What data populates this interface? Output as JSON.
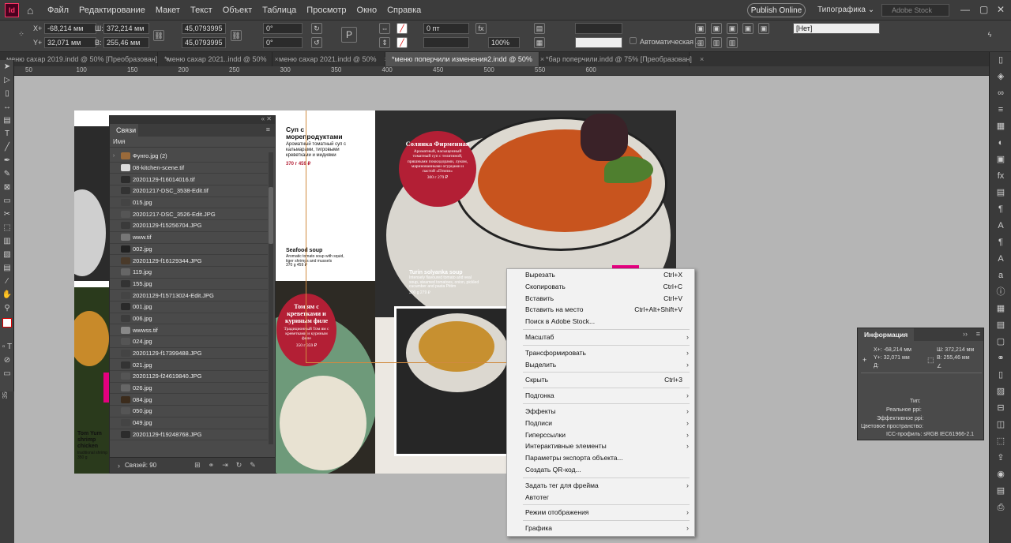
{
  "app": {
    "logo": "Id"
  },
  "menu": [
    "Файл",
    "Редактирование",
    "Макет",
    "Текст",
    "Объект",
    "Таблица",
    "Просмотр",
    "Окно",
    "Справка"
  ],
  "topbar": {
    "publish": "Publish Online",
    "workspace": "Типографика",
    "stock_placeholder": "Adobe Stock"
  },
  "control": {
    "x_label": "X+",
    "x_value": "-68,214 мм",
    "y_label": "Y+",
    "y_value": "32,071 мм",
    "w_label": "Ш:",
    "w_value": "372,214 мм",
    "h_label": "В:",
    "h_value": "255,46 мм",
    "scale_x": "45,0793995",
    "scale_y": "45,0793995",
    "rotate": "0°",
    "shear": "0°",
    "stroke": "0 пт",
    "opacity": "100%",
    "auto_fit": "Автоматическая ...",
    "style": "[Нет]"
  },
  "tabs": [
    {
      "label": "меню сахар 2019.indd @ 50% [Преобразован]",
      "active": false
    },
    {
      "label": "*меню сахар 2021..indd @ 50%",
      "active": false
    },
    {
      "label": "меню сахар 2021.indd @ 50%",
      "active": false
    },
    {
      "label": "*меню поперчили изменения2.indd @ 50%",
      "active": true
    },
    {
      "label": "*бар поперчили.indd @ 75% [Преобразован]",
      "active": false
    }
  ],
  "ruler": {
    "h": [
      "50",
      "100",
      "150",
      "200",
      "250",
      "300",
      "350",
      "400",
      "450",
      "500",
      "550",
      "600"
    ],
    "v": [
      "300",
      "350"
    ]
  },
  "layout_text": {
    "soup_sea_title": "Суп с морепродуктами",
    "soup_sea_desc": "Ароматный томатный суп с кальмарами, тигровыми креветками и мидиями",
    "soup_sea_price": "370 г 459 ₽",
    "seafood_title": "Seafood soup",
    "seafood_desc": "Aromatic tomato soup with squid, tiger shrimps and mussels",
    "seafood_price": "370 g 459 ₽",
    "solyanka_title": "Солянка Фирменная",
    "solyanka_desc": "Ароматный, насыщенный томатный суп с телятиной, пряшными поккидорами, луком, маринованными огурцами и пастой «Птипи»",
    "solyanka_price": "300 г 279 ₽",
    "turin_title": "Turin solyanka soup",
    "turin_desc": "Intensely flavoured tomato and veal soup, steamed tomatoes, onion, pickled cucumber and pasta Ptitim",
    "turin_price": "300 g 279 ₽",
    "tomyam_title": "Том ям с креветками и куриным филе",
    "tomyam_desc": "Традиционный Том ям с креветками и куриным филе",
    "tomyam_price": "350 г 359 ₽",
    "tomyum_title": "Tom Yum shrimp chicken",
    "tomyum_desc": "traditional shrimp",
    "tomyum_price": "350 g"
  },
  "links_panel": {
    "tab": "Связи",
    "column": "Имя",
    "items": [
      {
        "name": "Фунго.jpg (2)",
        "expand": true
      },
      {
        "name": "08-kitchen-scene.tif"
      },
      {
        "name": "20201129-f16014016.tif"
      },
      {
        "name": "20201217-DSC_3538-Edit.tif"
      },
      {
        "name": "015.jpg"
      },
      {
        "name": "20201217-DSC_3526-Edit.JPG"
      },
      {
        "name": "20201129-f15256704.JPG"
      },
      {
        "name": "www.tif"
      },
      {
        "name": "002.jpg"
      },
      {
        "name": "20201129-f16129344.JPG"
      },
      {
        "name": "119.jpg"
      },
      {
        "name": "155.jpg"
      },
      {
        "name": "20201129-f15713024-Edit.JPG"
      },
      {
        "name": "001.jpg"
      },
      {
        "name": "006.jpg"
      },
      {
        "name": "wwwss.tif"
      },
      {
        "name": "024.jpg"
      },
      {
        "name": "20201129-f17399488.JPG"
      },
      {
        "name": "021.jpg"
      },
      {
        "name": "20201129-f24619840.JPG"
      },
      {
        "name": "026.jpg"
      },
      {
        "name": "084.jpg"
      },
      {
        "name": "050.jpg"
      },
      {
        "name": "049.jpg"
      },
      {
        "name": "20201129-f19248768.JPG"
      }
    ],
    "footer": "Связей: 90"
  },
  "context_menu": [
    {
      "label": "Вырезать",
      "shortcut": "Ctrl+X"
    },
    {
      "label": "Скопировать",
      "shortcut": "Ctrl+C"
    },
    {
      "label": "Вставить",
      "shortcut": "Ctrl+V"
    },
    {
      "label": "Вставить на место",
      "shortcut": "Ctrl+Alt+Shift+V"
    },
    {
      "label": "Поиск в Adobe Stock...",
      "shortcut": ""
    },
    {
      "sep": true
    },
    {
      "label": "Масштаб",
      "sub": true
    },
    {
      "sep": true
    },
    {
      "label": "Трансформировать",
      "sub": true
    },
    {
      "label": "Выделить",
      "sub": true
    },
    {
      "sep": true
    },
    {
      "label": "Скрыть",
      "shortcut": "Ctrl+3"
    },
    {
      "sep": true
    },
    {
      "label": "Подгонка",
      "sub": true
    },
    {
      "sep": true
    },
    {
      "label": "Эффекты",
      "sub": true
    },
    {
      "label": "Подписи",
      "sub": true
    },
    {
      "label": "Гиперссылки",
      "sub": true
    },
    {
      "label": "Интерактивные элементы",
      "sub": true
    },
    {
      "label": "Параметры экспорта объекта...",
      "shortcut": ""
    },
    {
      "label": "Создать QR-код...",
      "shortcut": ""
    },
    {
      "sep": true
    },
    {
      "label": "Задать тег для фрейма",
      "sub": true
    },
    {
      "label": "Автотег",
      "shortcut": ""
    },
    {
      "sep": true
    },
    {
      "label": "Режим отображения",
      "sub": true
    },
    {
      "sep": true
    },
    {
      "label": "Графика",
      "sub": true
    }
  ],
  "info_panel": {
    "tab": "Информация",
    "x": "X+: -68,214 мм",
    "y": "Y+: 32,071 мм",
    "d": "Д:",
    "w": "Ш: 372,214 мм",
    "h": "В: 255,46 мм",
    "type": "Тип:",
    "real_ppi": "Реальное ppi:",
    "eff_ppi": "Эффективное ppi:",
    "color_space": "Цветовое пространство:",
    "icc": "ICC-профиль: sRGB IEC61966-2.1"
  },
  "colors": {
    "accent_red": "#b31f35",
    "pink": "#e4007f",
    "selection": "#d08a40"
  }
}
